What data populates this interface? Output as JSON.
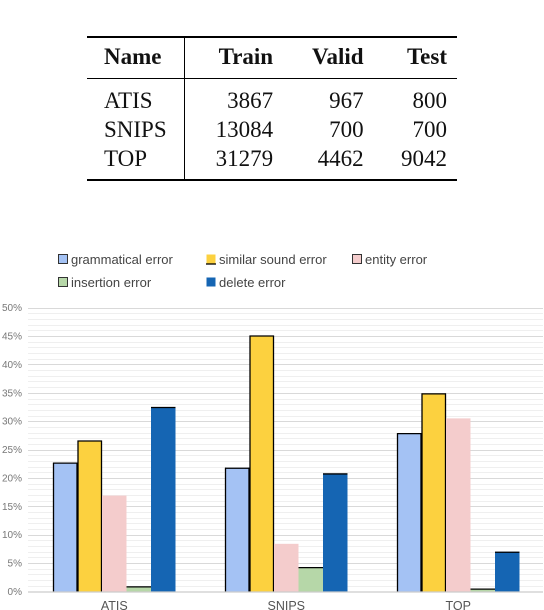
{
  "table": {
    "columns": [
      "Name",
      "Train",
      "Valid",
      "Test"
    ],
    "rows": [
      {
        "name": "ATIS",
        "train": "3867",
        "valid": "967",
        "test": "800"
      },
      {
        "name": "SNIPS",
        "train": "13084",
        "valid": "700",
        "test": "700"
      },
      {
        "name": "TOP",
        "train": "31279",
        "valid": "4462",
        "test": "9042"
      }
    ]
  },
  "chart_data": {
    "type": "bar",
    "title": "",
    "xlabel": "",
    "ylabel": "",
    "categories": [
      "ATIS",
      "SNIPS",
      "TOP"
    ],
    "ylim": [
      0,
      50
    ],
    "yticks": [
      "0%",
      "5%",
      "10%",
      "15%",
      "20%",
      "25%",
      "30%",
      "35%",
      "40%",
      "45%",
      "50%"
    ],
    "grid": true,
    "legend_position": "top",
    "series": [
      {
        "name": "grammatical error",
        "color": "#a4c2f4",
        "outlined": true,
        "values": [
          22.7,
          21.8,
          27.9
        ]
      },
      {
        "name": "similar sound error",
        "color": "#fcd13f",
        "outlined": true,
        "values": [
          26.6,
          45.1,
          34.9
        ]
      },
      {
        "name": "entity error",
        "color": "#f4cccc",
        "outlined": false,
        "values": [
          16.9,
          8.4,
          30.5
        ]
      },
      {
        "name": "insertion error",
        "color": "#b6d7a8",
        "outlined": false,
        "values": [
          0.9,
          4.3,
          0.5
        ]
      },
      {
        "name": "delete error",
        "color": "#1565b3",
        "outlined": false,
        "values": [
          32.5,
          20.8,
          7.0
        ]
      }
    ]
  }
}
